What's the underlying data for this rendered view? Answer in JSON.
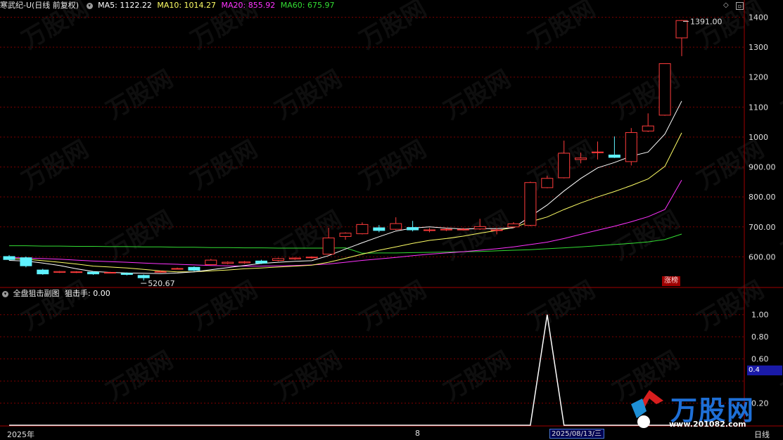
{
  "header": {
    "security": "寒武纪-U(日线 前复权)",
    "ma5": "MA5: 1122.22",
    "ma10": "MA10: 1014.27",
    "ma20": "MA20: 855.92",
    "ma60": "MA60: 675.97"
  },
  "colors": {
    "up": "#ff3b3b",
    "down": "#5ff2ff",
    "ma5": "#ffffff",
    "ma10": "#ffff66",
    "ma20": "#ff33ff",
    "ma60": "#33dd33",
    "grid": "#7a0000",
    "frame": "#a00000",
    "axis_text": "#e0e0e0",
    "indicator": "#ffffff"
  },
  "subchart": {
    "title": "全盘狙击副图",
    "indicator_label": "狙击手: 0.00",
    "current_badge": "0.4"
  },
  "bottom": {
    "left_label": "2025年",
    "month_label": "8",
    "date_box": "2025/08/13/三",
    "right_label": "日线"
  },
  "annotations": {
    "high_label": "1391.00",
    "low_label": "520.67",
    "tag": "涨榜"
  },
  "watermark": {
    "brand": "万股网",
    "url": "www.201082.com"
  },
  "chart_data": [
    {
      "type": "candlestick",
      "title": "",
      "ylim": [
        500,
        1420
      ],
      "y_ticks": [
        "600.00",
        "700.00",
        "800.00",
        "900.00",
        "1000",
        "1100",
        "1200",
        "1300",
        "1400"
      ],
      "y_tick_values": [
        600,
        700,
        800,
        900,
        1000,
        1100,
        1200,
        1300,
        1400
      ],
      "candles": [
        {
          "o": 601,
          "c": 591,
          "h": 606,
          "l": 588
        },
        {
          "o": 597,
          "c": 570,
          "h": 601,
          "l": 565
        },
        {
          "o": 556,
          "c": 543,
          "h": 560,
          "l": 540
        },
        {
          "o": 548,
          "c": 551,
          "h": 553,
          "l": 546
        },
        {
          "o": 549,
          "c": 550,
          "h": 552,
          "l": 546
        },
        {
          "o": 549,
          "c": 543,
          "h": 552,
          "l": 540
        },
        {
          "o": 547,
          "c": 548,
          "h": 550,
          "l": 545
        },
        {
          "o": 545,
          "c": 541,
          "h": 548,
          "l": 538
        },
        {
          "o": 538,
          "c": 530,
          "h": 541,
          "l": 521
        },
        {
          "o": 550,
          "c": 551,
          "h": 555,
          "l": 547
        },
        {
          "o": 560,
          "c": 561,
          "h": 564,
          "l": 558
        },
        {
          "o": 565,
          "c": 555,
          "h": 568,
          "l": 552
        },
        {
          "o": 574,
          "c": 589,
          "h": 593,
          "l": 571
        },
        {
          "o": 578,
          "c": 582,
          "h": 585,
          "l": 575
        },
        {
          "o": 580,
          "c": 583,
          "h": 586,
          "l": 577
        },
        {
          "o": 586,
          "c": 579,
          "h": 590,
          "l": 576
        },
        {
          "o": 588,
          "c": 594,
          "h": 597,
          "l": 585
        },
        {
          "o": 593,
          "c": 596,
          "h": 598,
          "l": 590
        },
        {
          "o": 597,
          "c": 599,
          "h": 602,
          "l": 594
        },
        {
          "o": 609,
          "c": 663,
          "h": 697,
          "l": 607
        },
        {
          "o": 668,
          "c": 679,
          "h": 682,
          "l": 657
        },
        {
          "o": 677,
          "c": 708,
          "h": 715,
          "l": 675
        },
        {
          "o": 697,
          "c": 688,
          "h": 706,
          "l": 682
        },
        {
          "o": 692,
          "c": 711,
          "h": 732,
          "l": 689
        },
        {
          "o": 698,
          "c": 690,
          "h": 720,
          "l": 685
        },
        {
          "o": 688,
          "c": 690,
          "h": 696,
          "l": 682
        },
        {
          "o": 690,
          "c": 692,
          "h": 696,
          "l": 686
        },
        {
          "o": 691,
          "c": 692,
          "h": 697,
          "l": 688
        },
        {
          "o": 693,
          "c": 701,
          "h": 727,
          "l": 690
        },
        {
          "o": 689,
          "c": 690,
          "h": 696,
          "l": 675
        },
        {
          "o": 700,
          "c": 710,
          "h": 716,
          "l": 696
        },
        {
          "o": 705,
          "c": 848,
          "h": 851,
          "l": 702
        },
        {
          "o": 831,
          "c": 862,
          "h": 871,
          "l": 829
        },
        {
          "o": 864,
          "c": 946,
          "h": 988,
          "l": 862
        },
        {
          "o": 925,
          "c": 930,
          "h": 948,
          "l": 912
        },
        {
          "o": 950,
          "c": 950,
          "h": 985,
          "l": 925
        },
        {
          "o": 940,
          "c": 932,
          "h": 1002,
          "l": 930
        },
        {
          "o": 918,
          "c": 1015,
          "h": 1030,
          "l": 905
        },
        {
          "o": 1020,
          "c": 1037,
          "h": 1079,
          "l": 1017
        },
        {
          "o": 1073,
          "c": 1245,
          "h": 1245,
          "l": 1071
        },
        {
          "o": 1331,
          "c": 1389,
          "h": 1391,
          "l": 1270
        }
      ],
      "ma5": [
        588,
        586,
        579,
        571,
        560,
        551,
        548,
        546,
        545,
        544,
        546,
        550,
        557,
        564,
        571,
        578,
        582,
        585,
        587,
        604,
        626,
        647,
        667,
        686,
        696,
        700,
        696,
        693,
        694,
        694,
        697,
        735,
        773,
        820,
        862,
        897,
        915,
        936,
        950,
        1010,
        1120
      ],
      "ma10": [
        594,
        592,
        587,
        582,
        576,
        569,
        566,
        563,
        558,
        553,
        550,
        550,
        553,
        556,
        560,
        563,
        566,
        569,
        572,
        582,
        595,
        609,
        622,
        633,
        645,
        655,
        661,
        669,
        679,
        688,
        698,
        717,
        733,
        758,
        780,
        800,
        818,
        838,
        860,
        902,
        1014
      ],
      "ma20": [
        598,
        596,
        594,
        592,
        589,
        586,
        584,
        582,
        579,
        577,
        575,
        573,
        571,
        570,
        569,
        569,
        570,
        571,
        573,
        576,
        582,
        588,
        593,
        598,
        604,
        609,
        613,
        617,
        622,
        627,
        633,
        641,
        649,
        661,
        675,
        689,
        702,
        717,
        734,
        758,
        856
      ],
      "ma60": [
        637,
        637,
        636,
        636,
        635,
        635,
        634,
        634,
        633,
        633,
        632,
        632,
        631,
        631,
        630,
        630,
        629,
        629,
        629,
        629,
        630,
        612,
        613,
        613,
        614,
        615,
        616,
        617,
        618,
        620,
        622,
        624,
        627,
        630,
        633,
        637,
        641,
        645,
        650,
        658,
        676
      ]
    },
    {
      "type": "line",
      "title": "",
      "series_name": "狙击手",
      "ylim": [
        0,
        1.1
      ],
      "y_ticks": [
        "0.20",
        "0.40",
        "0.60",
        "0.80",
        "1.00"
      ],
      "y_tick_values": [
        0.2,
        0.4,
        0.6,
        0.8,
        1.0
      ],
      "values": [
        0,
        0,
        0,
        0,
        0,
        0,
        0,
        0,
        0,
        0,
        0,
        0,
        0,
        0,
        0,
        0,
        0,
        0,
        0,
        0,
        0,
        0,
        0,
        0,
        0,
        0,
        0,
        0,
        0,
        0,
        0,
        0,
        1.0,
        0,
        0,
        0,
        0,
        0,
        0,
        0,
        0
      ]
    }
  ]
}
